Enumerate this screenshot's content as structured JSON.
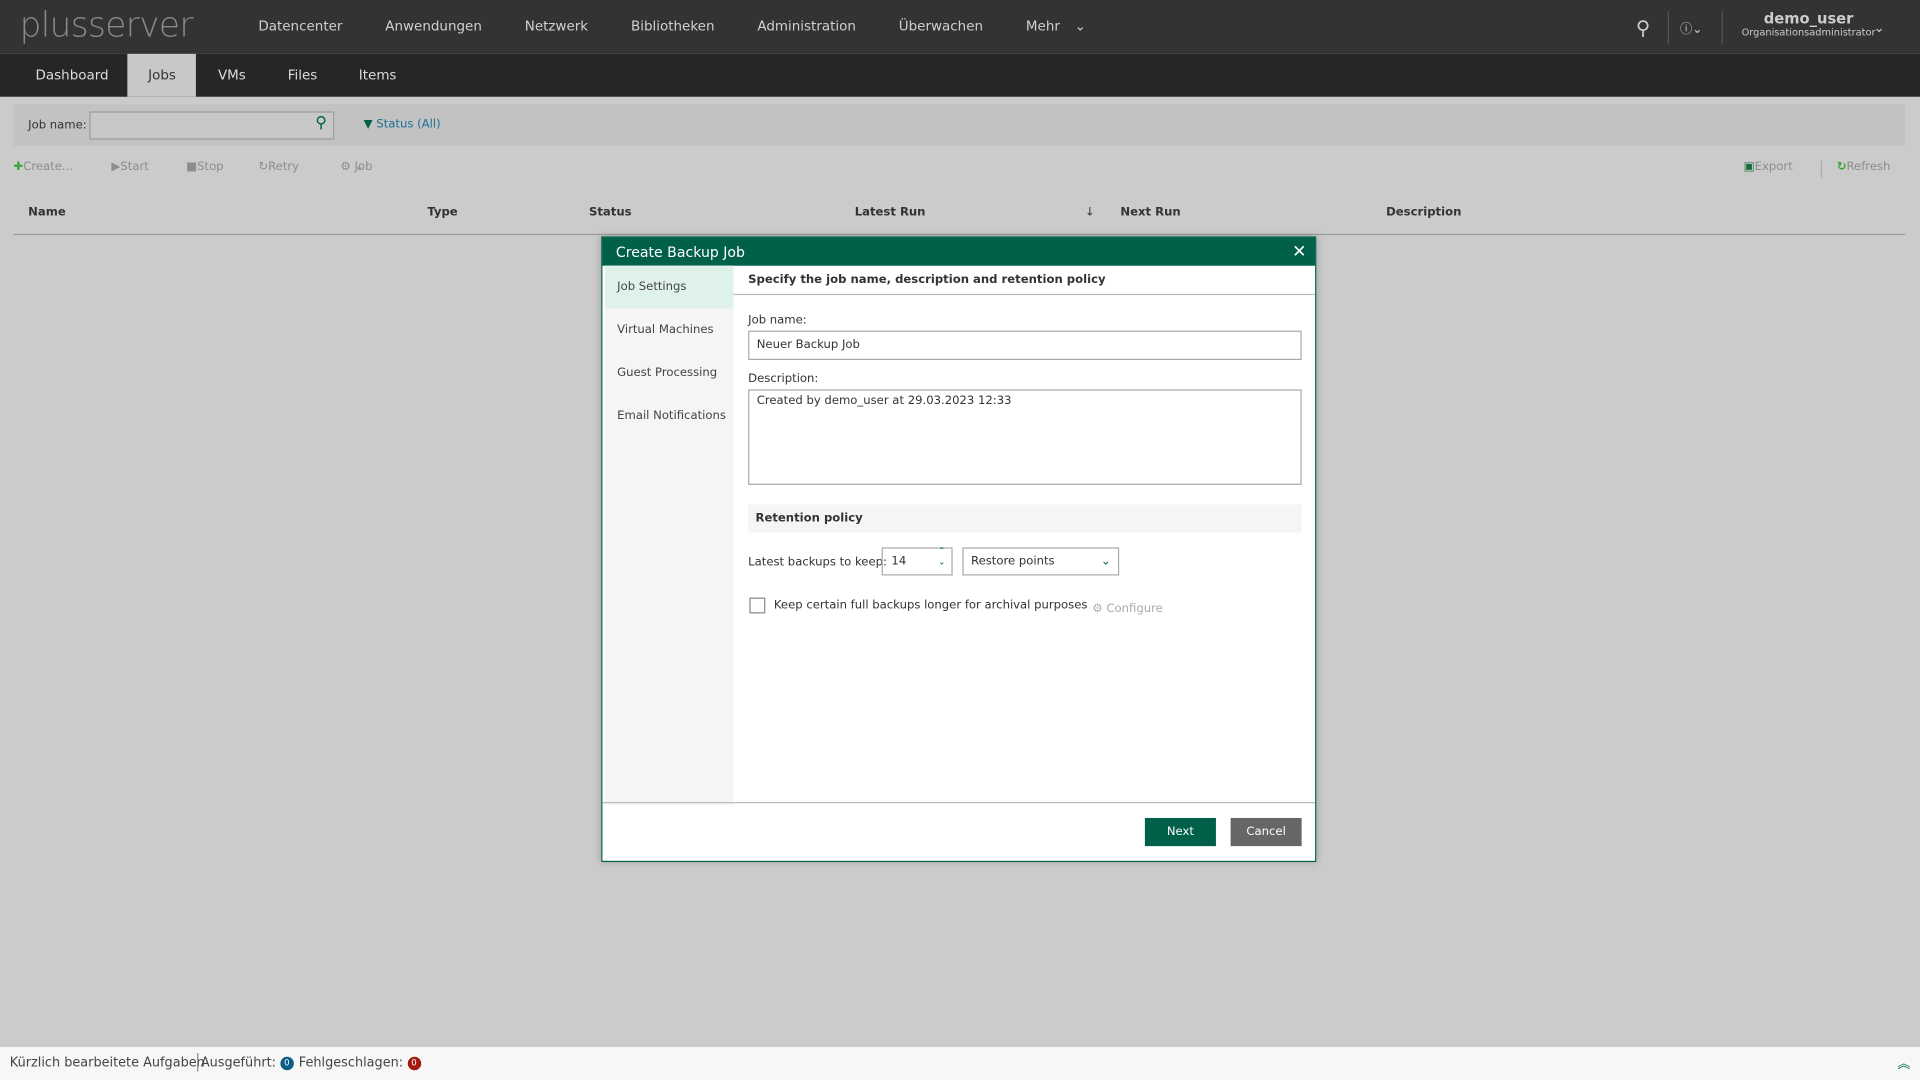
{
  "header": {
    "logo": "plusserver",
    "nav": [
      "Datencenter",
      "Anwendungen",
      "Netzwerk",
      "Bibliotheken",
      "Administration",
      "Überwachen",
      "Mehr"
    ],
    "user": "demo_user",
    "role": "Organisationsadministrator"
  },
  "subnav": {
    "tabs": [
      "Dashboard",
      "Jobs",
      "VMs",
      "Files",
      "Items"
    ],
    "active": "Jobs"
  },
  "filter": {
    "label": "Job name:",
    "value": "",
    "status": "Status (All)"
  },
  "toolbar": {
    "create": "Create...",
    "start": "Start",
    "stop": "Stop",
    "retry": "Retry",
    "job": "Job",
    "export": "Export",
    "refresh": "Refresh"
  },
  "table": {
    "columns": [
      "Name",
      "Type",
      "Status",
      "Latest Run",
      "Next Run",
      "Description"
    ],
    "sort": "Latest Run descending"
  },
  "dialog": {
    "title": "Create Backup Job",
    "steps": [
      "Job Settings",
      "Virtual Machines",
      "Guest Processing",
      "Email Notifications"
    ],
    "active_step": "Job Settings",
    "heading": "Specify the job name, description and retention policy",
    "job_name_label": "Job name:",
    "job_name": "Neuer Backup Job",
    "description_label": "Description:",
    "description": "Created by demo_user at 29.03.2023 12:33",
    "retention_title": "Retention policy",
    "keep_label": "Latest backups to keep:",
    "keep_value": "14",
    "keep_unit": "Restore points",
    "archival_label": "Keep certain full backups longer for archival purposes",
    "archival_checked": false,
    "configure": "Configure",
    "next": "Next",
    "cancel": "Cancel"
  },
  "statusbar": {
    "recent": "Kürzlich bearbeitete Aufgaben",
    "executed_label": "Ausgeführt:",
    "executed": "0",
    "failed_label": "Fehlgeschlagen:",
    "failed": "0"
  },
  "colors": {
    "accent": "#00604a",
    "executed": "#0b5c86",
    "failed": "#a01a10"
  }
}
